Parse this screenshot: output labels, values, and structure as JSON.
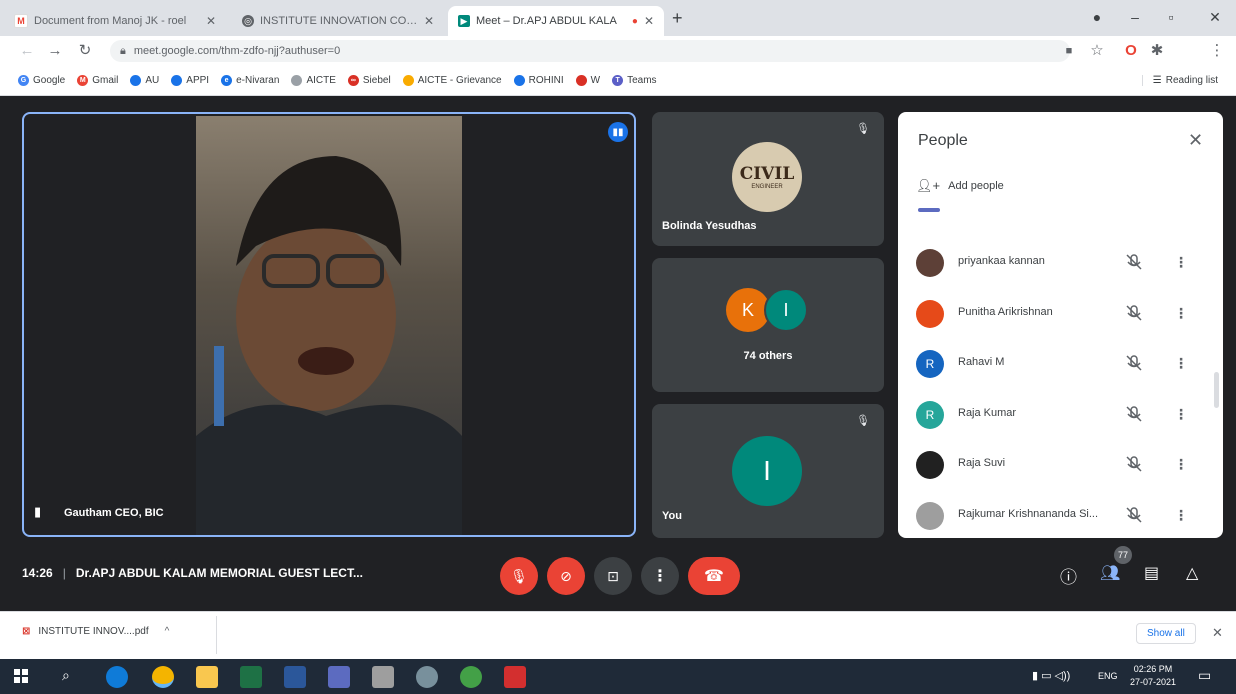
{
  "browser": {
    "tabs": [
      {
        "label": "Document from Manoj JK - roel",
        "favicon": "gmail-icon",
        "active": false
      },
      {
        "label": "INSTITUTE INNOVATION COUN",
        "favicon": "globe-icon",
        "active": false
      },
      {
        "label": "Meet – Dr.APJ ABDUL KALA",
        "favicon": "meet-icon",
        "active": true
      }
    ],
    "url": "meet.google.com/thm-zdfo-njj?authuser=0",
    "bookmarks": [
      "Google",
      "Gmail",
      "AU",
      "APPI",
      "e-Nivaran",
      "AICTE",
      "Siebel",
      "AICTE - Grievance",
      "ROHINI",
      "W",
      "Teams"
    ],
    "reading_list": "Reading list"
  },
  "meet": {
    "main_tile": {
      "name": "Gautham CEO, BIC"
    },
    "tiles": [
      {
        "name": "Bolinda Yesudhas",
        "logo_text": "CIVIL",
        "logo_sub": "ENGINEER"
      },
      {
        "name": "74 others",
        "avatars": [
          "K",
          "I"
        ]
      },
      {
        "name": "You",
        "avatar": "I"
      }
    ],
    "people_panel": {
      "title": "People",
      "add_people": "Add people",
      "participants": [
        {
          "name": "priyankaa kannan",
          "avatar_color": "#5d4037",
          "initial": ""
        },
        {
          "name": "Punitha Arikrishnan",
          "avatar_color": "#e64a19",
          "initial": ""
        },
        {
          "name": "Rahavi M",
          "avatar_color": "#1565c0",
          "initial": "R"
        },
        {
          "name": "Raja Kumar",
          "avatar_color": "#26a69a",
          "initial": "R"
        },
        {
          "name": "Raja Suvi",
          "avatar_color": "#212121",
          "initial": ""
        },
        {
          "name": "Rajkumar Krishnananda Si...",
          "avatar_color": "#9e9e9e",
          "initial": ""
        }
      ]
    },
    "bottom_bar": {
      "time": "14:26",
      "meeting_title": "Dr.APJ ABDUL KALAM MEMORIAL GUEST LECT...",
      "participant_count": "77"
    }
  },
  "downloads": {
    "file": "INSTITUTE INNOV....pdf",
    "show_all": "Show all"
  },
  "taskbar": {
    "language": "ENG",
    "time": "02:26 PM",
    "date": "27-07-2021"
  },
  "colors": {
    "meet_bg": "#202124",
    "tile_bg": "#3c4043",
    "end_call": "#ea4335",
    "avatar_teal": "#00897b",
    "avatar_orange": "#e8710a"
  }
}
